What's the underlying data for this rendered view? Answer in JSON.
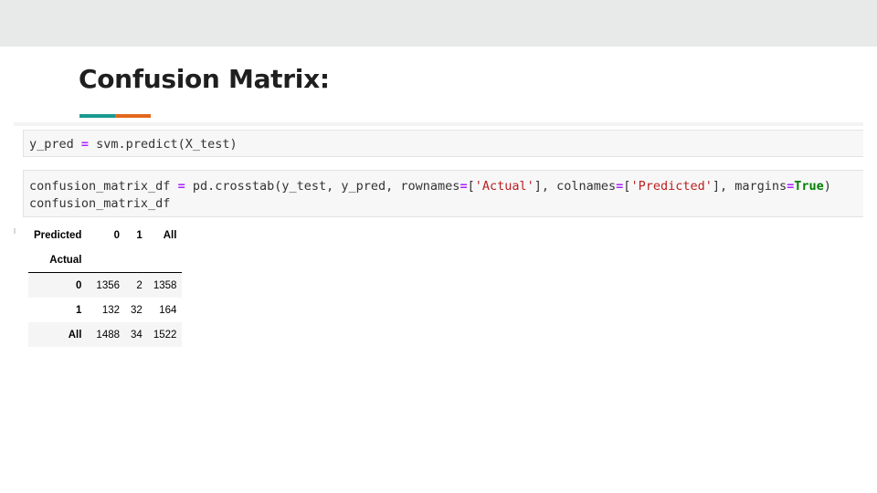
{
  "slide": {
    "title": "Confusion Matrix:",
    "accent_colors": [
      "#1a9a90",
      "#e3691d"
    ]
  },
  "cells": [
    {
      "tokens": [
        {
          "t": "y_pred ",
          "c": ""
        },
        {
          "t": "=",
          "c": "op"
        },
        {
          "t": " svm.predict(X_test)",
          "c": ""
        }
      ]
    },
    {
      "tokens": [
        {
          "t": "confusion_matrix_df ",
          "c": ""
        },
        {
          "t": "=",
          "c": "op"
        },
        {
          "t": " pd.crosstab(y_test, y_pred, rownames",
          "c": ""
        },
        {
          "t": "=",
          "c": "op"
        },
        {
          "t": "[",
          "c": ""
        },
        {
          "t": "'Actual'",
          "c": "str"
        },
        {
          "t": "], colnames",
          "c": ""
        },
        {
          "t": "=",
          "c": "op"
        },
        {
          "t": "[",
          "c": ""
        },
        {
          "t": "'Predicted'",
          "c": "str"
        },
        {
          "t": "], margins",
          "c": ""
        },
        {
          "t": "=",
          "c": "op"
        },
        {
          "t": "True",
          "c": "kw"
        },
        {
          "t": ")\nconfusion_matrix_df",
          "c": ""
        }
      ]
    }
  ],
  "output_table": {
    "columns_name": "Predicted",
    "columns": [
      "0",
      "1",
      "All"
    ],
    "index_name": "Actual",
    "rows": [
      {
        "label": "0",
        "values": [
          "1356",
          "2",
          "1358"
        ]
      },
      {
        "label": "1",
        "values": [
          "132",
          "32",
          "164"
        ]
      },
      {
        "label": "All",
        "values": [
          "1488",
          "34",
          "1522"
        ]
      }
    ]
  }
}
